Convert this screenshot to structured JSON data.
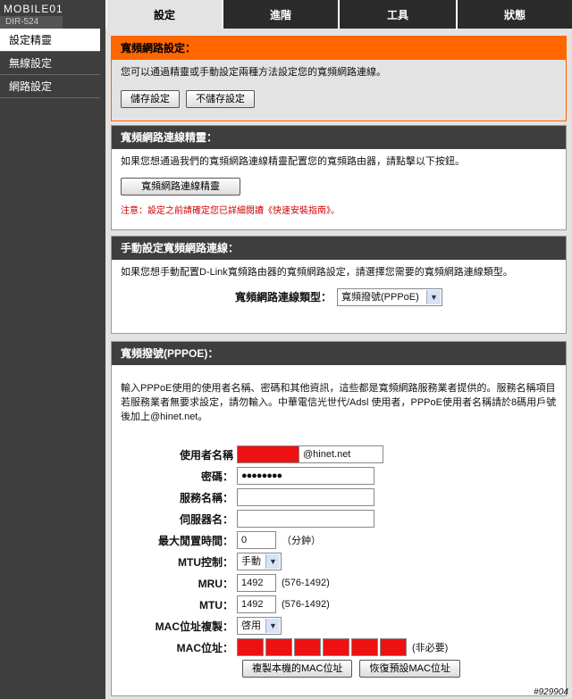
{
  "header": {
    "logo_text": "MOBILE01",
    "model": "DIR-524",
    "tabs": [
      {
        "label": "設定",
        "active": true
      },
      {
        "label": "進階",
        "active": false
      },
      {
        "label": "工具",
        "active": false
      },
      {
        "label": "狀態",
        "active": false
      }
    ]
  },
  "sidebar": {
    "items": [
      {
        "label": "設定精靈",
        "active": true
      },
      {
        "label": "無線設定",
        "active": false
      },
      {
        "label": "網路設定",
        "active": false
      }
    ]
  },
  "broadband": {
    "title": "寬頻網路設定：",
    "desc": "您可以通過精靈或手動設定兩種方法設定您的寬頻網路連線。",
    "save_label": "儲存設定",
    "nosave_label": "不儲存設定"
  },
  "wizard": {
    "title": "寬頻網路連線精靈：",
    "desc": "如果您想通過我們的寬頻網路連線精靈配置您的寬頻路由器，請點擊以下按鈕。",
    "button_label": "寬頻網路連線精靈",
    "note": "注意：設定之前請確定您已詳細閱讀《快速安裝指南》。"
  },
  "manual": {
    "title": "手動設定寬頻網路連線：",
    "desc": "如果您想手動配置D-Link寬頻路由器的寬頻網路設定，請選擇您需要的寬頻網路連線類型。",
    "type_label": "寬頻網路連線類型：",
    "type_value": "寬頻撥號(PPPoE)"
  },
  "pppoe": {
    "title": "寬頻撥號(PPPOE)：",
    "desc": "輸入PPPoE使用的使用者名稱、密碼和其他資訊，這些都是寬頻網路服務業者提供的。服務名稱項目若服務業者無要求設定，請勿輸入。中華電信光世代/Adsl 使用者，PPPoE使用者名稱請於8碼用戶號後加上@hinet.net。",
    "username_label": "使用者名稱",
    "username_suffix": "@hinet.net",
    "password_label": "密碼：",
    "password_value": "●●●●●●●●",
    "service_label": "服務名稱：",
    "server_label": "伺服器名：",
    "idle_label": "最大閒置時間：",
    "idle_value": "0",
    "idle_unit": "（分鈡）",
    "mtu_ctrl_label": "MTU控制：",
    "mtu_ctrl_value": "手動",
    "mru_label": "MRU：",
    "mru_value": "1492",
    "mru_range": "(576-1492)",
    "mtu_label": "MTU：",
    "mtu_value": "1492",
    "mtu_range": "(576-1492)",
    "mac_clone_label": "MAC位址複製：",
    "mac_clone_value": "啓用",
    "mac_label": "MAC位址：",
    "mac_optional": "(非必要)",
    "copy_mac_label": "複製本機的MAC位址",
    "restore_mac_label": "恢復預設MAC位址"
  },
  "watermark": "#929904"
}
